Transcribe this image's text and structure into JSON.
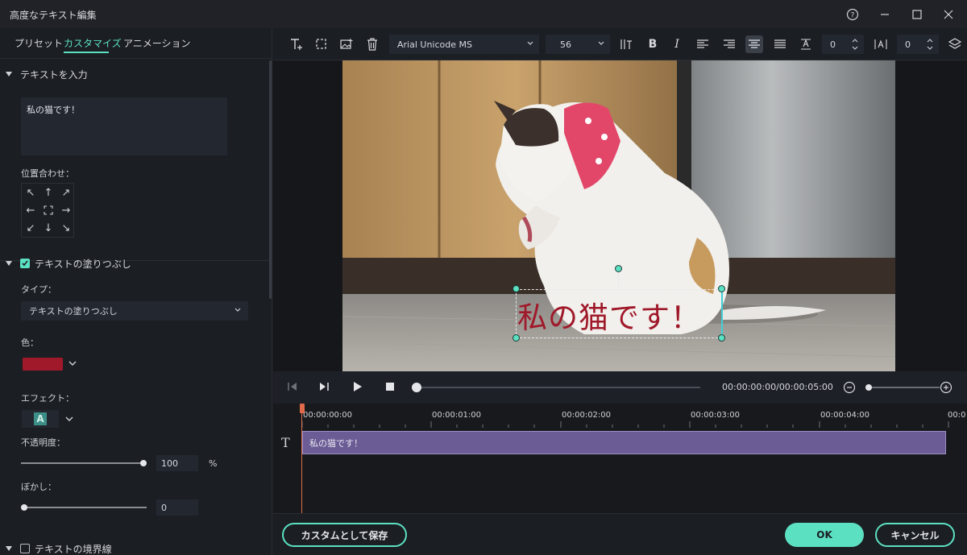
{
  "window": {
    "title": "高度なテキスト編集"
  },
  "tabs": [
    {
      "label": "プリセット"
    },
    {
      "label": "カスタマイズ"
    },
    {
      "label": "アニメーション"
    }
  ],
  "text_input": {
    "section_label": "テキストを入力",
    "value": "私の猫です！"
  },
  "position": {
    "label": "位置合わせ："
  },
  "fill": {
    "section_label": "テキストの塗りつぶし",
    "checked": true,
    "type_label": "タイプ：",
    "type_value": "テキストの塗りつぶし",
    "color_label": "色：",
    "color": "#a0192a",
    "effect_label": "エフェクト：",
    "effect_glyph": "A",
    "opacity_label": "不透明度：",
    "opacity_value": "100",
    "opacity_unit": "%",
    "opacity_level": 1.0,
    "blur_label": "ぼかし：",
    "blur_value": "0",
    "blur_level": 0
  },
  "border": {
    "section_label": "テキストの境界線",
    "checked": false
  },
  "toolbar": {
    "font": "Arial Unicode MS",
    "size": "56",
    "bold": "B",
    "italic": "I",
    "char_spacing": "0",
    "line_spacing": "0"
  },
  "preview": {
    "overlay_text": "私の猫です！"
  },
  "playback": {
    "timecode": "00:00:00:00/00:00:05:00",
    "progress": 0
  },
  "timeline": {
    "ruler": [
      "00:00:00:00",
      "00:00:01:00",
      "00:00:02:00",
      "00:00:03:00",
      "00:00:04:00",
      "00:0"
    ],
    "clip_label": "私の猫です！",
    "track_icon": "T"
  },
  "buttons": {
    "save_custom": "カスタムとして保存",
    "ok": "OK",
    "cancel": "キャンセル"
  },
  "colors": {
    "accent": "#5ce0c2",
    "clip": "#6b5c95",
    "playhead": "#e06a4a"
  }
}
